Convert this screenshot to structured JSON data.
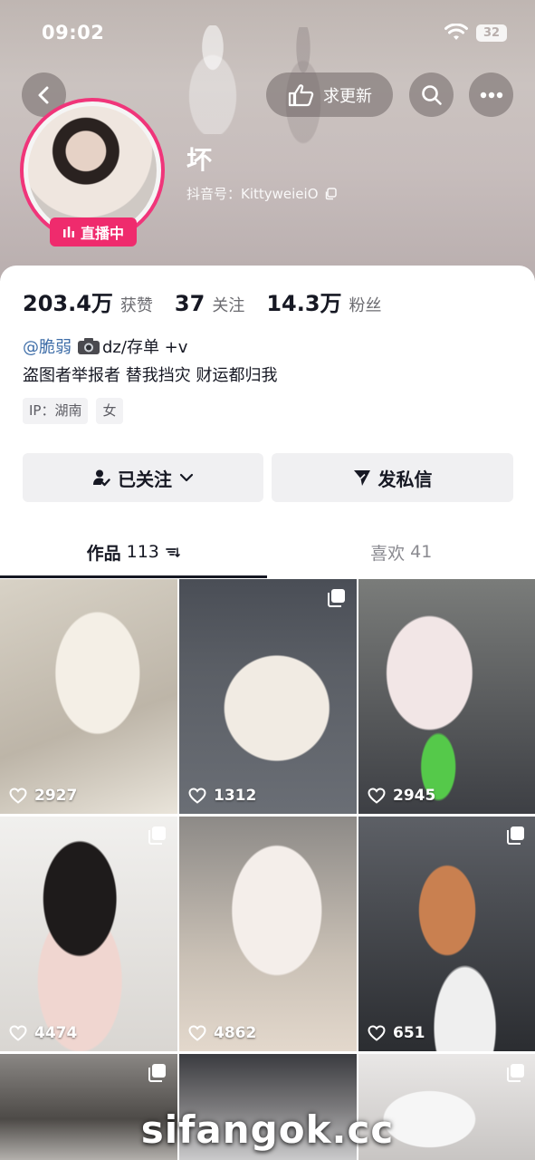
{
  "status_bar": {
    "time": "09:02",
    "battery": "32"
  },
  "header": {
    "update_button_label": "求更新"
  },
  "profile": {
    "nickname": "坏",
    "douyin_id": "抖音号：KittyweieiO",
    "live_badge": "直播中"
  },
  "stats": [
    {
      "value": "203.4万",
      "label": "获赞"
    },
    {
      "value": "37",
      "label": "关注"
    },
    {
      "value": "14.3万",
      "label": "粉丝"
    }
  ],
  "bio": {
    "mention": "@脆弱",
    "line1_rest": "dz/存单 +v",
    "line2": "盗图者举报者 替我挡灾 财运都归我",
    "tags": [
      "IP：湖南",
      "女"
    ]
  },
  "actions": {
    "follow_label": "已关注",
    "message_label": "发私信"
  },
  "tabs": [
    {
      "label": "作品",
      "count": "113",
      "active": true
    },
    {
      "label": "喜欢",
      "count": "41",
      "active": false
    }
  ],
  "posts": [
    {
      "likes": "2927",
      "multi": false
    },
    {
      "likes": "1312",
      "multi": true
    },
    {
      "likes": "2945",
      "multi": false
    },
    {
      "likes": "4474",
      "multi": true
    },
    {
      "likes": "4862",
      "multi": false
    },
    {
      "likes": "651",
      "multi": true
    },
    {
      "likes": "",
      "multi": true
    },
    {
      "likes": "",
      "multi": false
    },
    {
      "likes": "",
      "multi": true
    }
  ],
  "watermark": "sifangok.cc",
  "colors": {
    "live_pink": "#ef2b6d",
    "mention_blue": "#3f6ea8",
    "text_dark": "#161823"
  }
}
